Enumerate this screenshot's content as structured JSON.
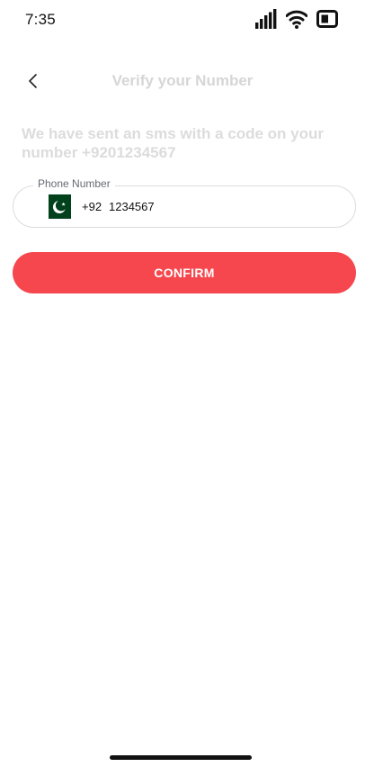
{
  "status_bar": {
    "time": "7:35",
    "icons": [
      "signal-icon",
      "wifi-icon",
      "battery-icon"
    ]
  },
  "header": {
    "title": "Verify your Number",
    "back_icon": "chevron-left-icon"
  },
  "message": {
    "text": "We have sent an sms with a code on your number +9201234567"
  },
  "phone_field": {
    "label": "Phone Number",
    "flag": "pakistan-flag-icon",
    "country_code": "+92",
    "number": "1234567"
  },
  "confirm": {
    "label": "CONFIRM"
  },
  "colors": {
    "accent": "#f5474d",
    "title_muted": "#d6d6d6",
    "border": "#dcdcdc",
    "flag_green": "#01411c"
  }
}
